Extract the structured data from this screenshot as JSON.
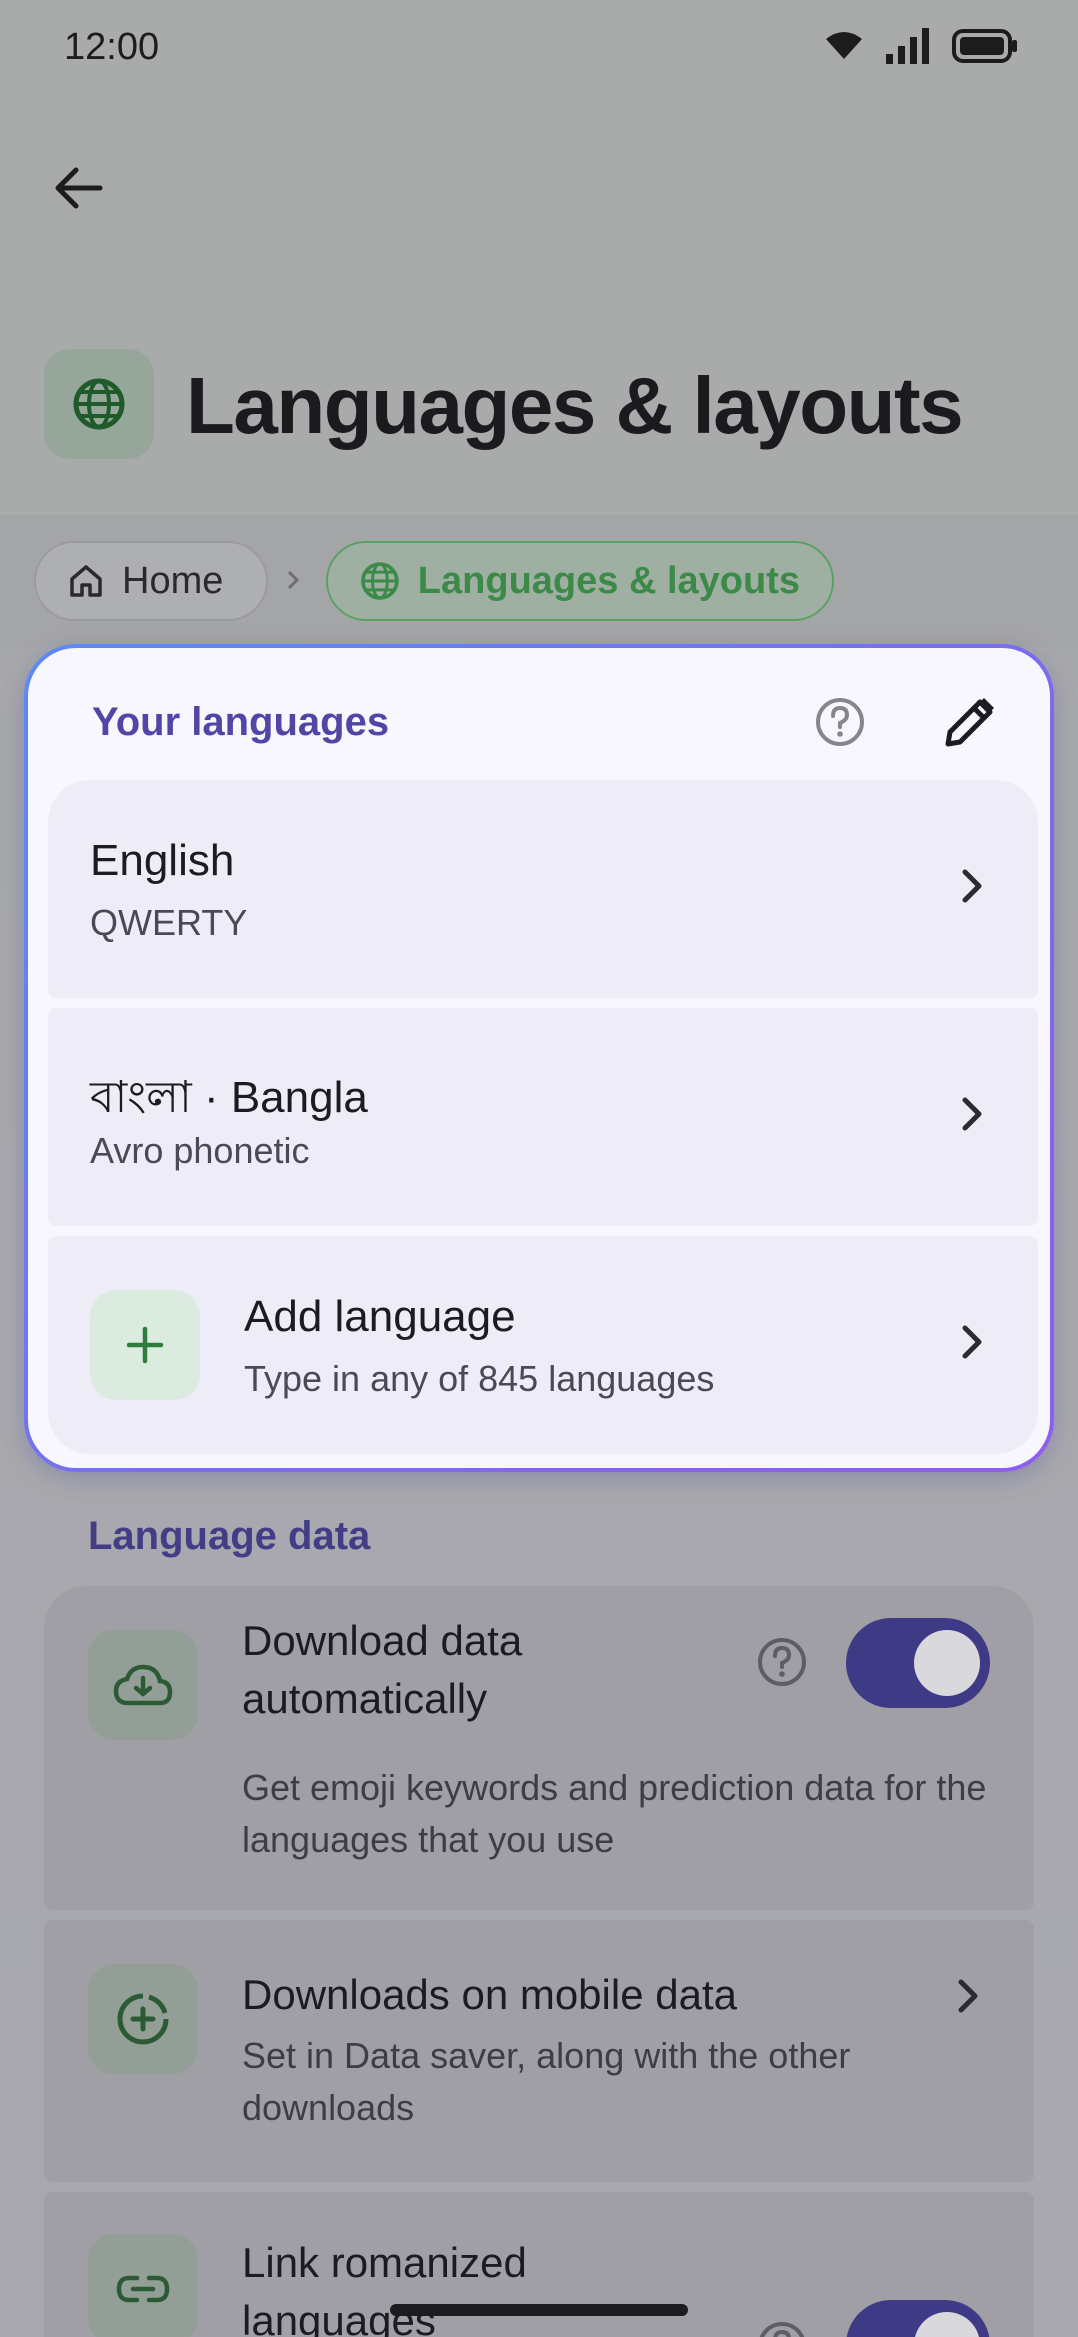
{
  "status_bar": {
    "time": "12:00"
  },
  "header": {
    "title": "Languages & layouts"
  },
  "breadcrumb": {
    "home_label": "Home",
    "current_label": "Languages & layouts"
  },
  "your_languages": {
    "title": "Your languages",
    "items": [
      {
        "primary": "English",
        "secondary": "QWERTY"
      },
      {
        "primary": "বাংলা · Bangla",
        "secondary": "Avro phonetic"
      }
    ],
    "add": {
      "primary": "Add language",
      "secondary": "Type in any of 845 languages"
    }
  },
  "language_data": {
    "title": "Language data",
    "items": [
      {
        "primary": "Download data automatically",
        "secondary": "Get emoji keywords and prediction data for the languages that you use",
        "toggle": true
      },
      {
        "primary": "Downloads on mobile data",
        "secondary": "Set in Data saver, along with the other downloads"
      },
      {
        "primary": "Link romanized languages",
        "toggle": true
      }
    ]
  },
  "colors": {
    "accent": "#5146a6",
    "green": "#3b8a47",
    "toggle_on": "#3f3a86"
  }
}
